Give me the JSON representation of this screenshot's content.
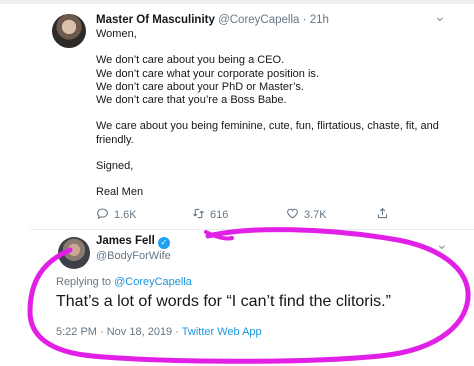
{
  "tweet": {
    "author_name": "Master Of Masculinity",
    "author_handle": "@CoreyCapella",
    "time_ago": "21h",
    "lines": [
      "Women,",
      "",
      "We don’t care about you being a CEO.",
      "We don’t care what your corporate position is.",
      "We don’t care about your PhD or Master’s.",
      "We don’t care that you’re a Boss Babe.",
      "",
      "We care about you being feminine, cute, fun, flirtatious, chaste, fit, and",
      "friendly.",
      "",
      "Signed,",
      "",
      "Real Men"
    ],
    "reply_count": "1.6K",
    "retweet_count": "616",
    "like_count": "3.7K"
  },
  "reply": {
    "author_name": "James Fell",
    "author_handle": "@BodyForWife",
    "replying_prefix": "Replying to",
    "replying_to": "@CoreyCapella",
    "text": "That’s a lot of words for “I can’t find the clitoris.”",
    "timestamp": "5:22 PM · Nov 18, 2019 ·",
    "source": "Twitter Web App"
  },
  "icons": {
    "reply": "reply-icon",
    "retweet": "retweet-icon",
    "like": "heart-icon",
    "share": "share-icon",
    "menu": "chevron-down-icon",
    "verified": "verified-badge-icon"
  },
  "colors": {
    "link": "#1b95e0",
    "verified": "#1da1f2",
    "highlight_circle": "#e21fe6",
    "muted_text": "#657786"
  }
}
